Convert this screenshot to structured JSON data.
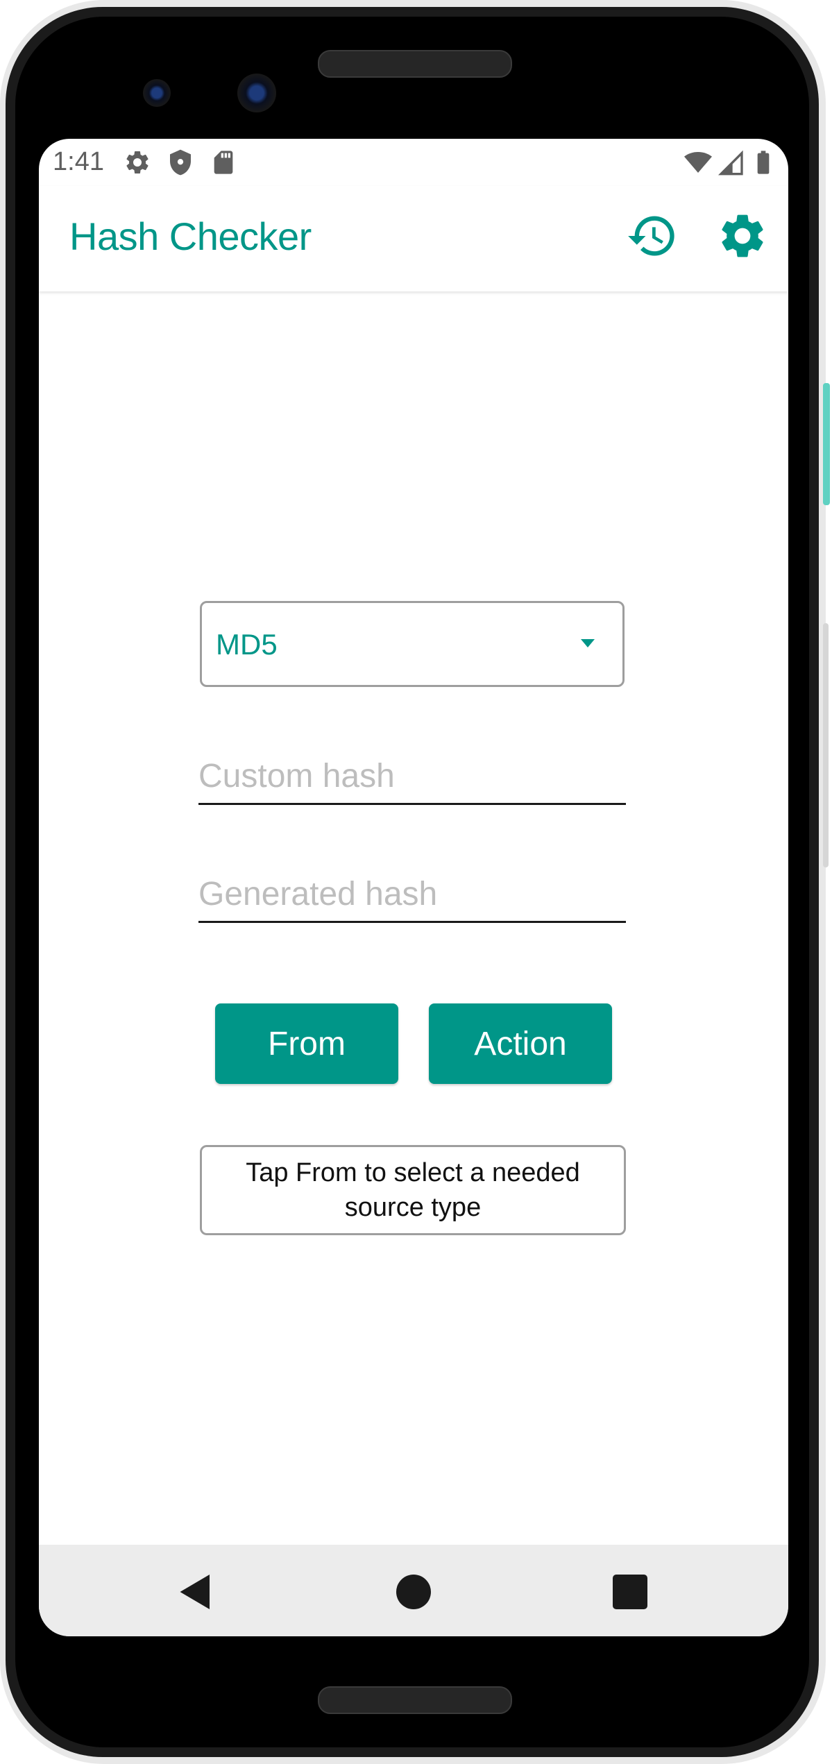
{
  "status_bar": {
    "time": "1:41",
    "left_icons": [
      "settings-icon",
      "shield-icon",
      "sd-card-icon"
    ],
    "right_icons": [
      "wifi-icon",
      "signal-icon",
      "battery-icon"
    ]
  },
  "app_bar": {
    "title": "Hash Checker",
    "actions": [
      "history-icon",
      "settings-icon"
    ]
  },
  "form": {
    "hash_type": {
      "selected": "MD5"
    },
    "custom_hash": {
      "value": "",
      "placeholder": "Custom hash"
    },
    "generated_hash": {
      "value": "",
      "placeholder": "Generated hash"
    },
    "from_button_label": "From",
    "action_button_label": "Action",
    "info_text": "Tap From to select a needed source type"
  },
  "nav_bar": {
    "buttons": [
      "back-icon",
      "home-icon",
      "recents-icon"
    ]
  },
  "colors": {
    "accent": "#009688",
    "nav_background": "#ececec",
    "border": "#9e9e9e",
    "placeholder": "#bdbdbd"
  }
}
